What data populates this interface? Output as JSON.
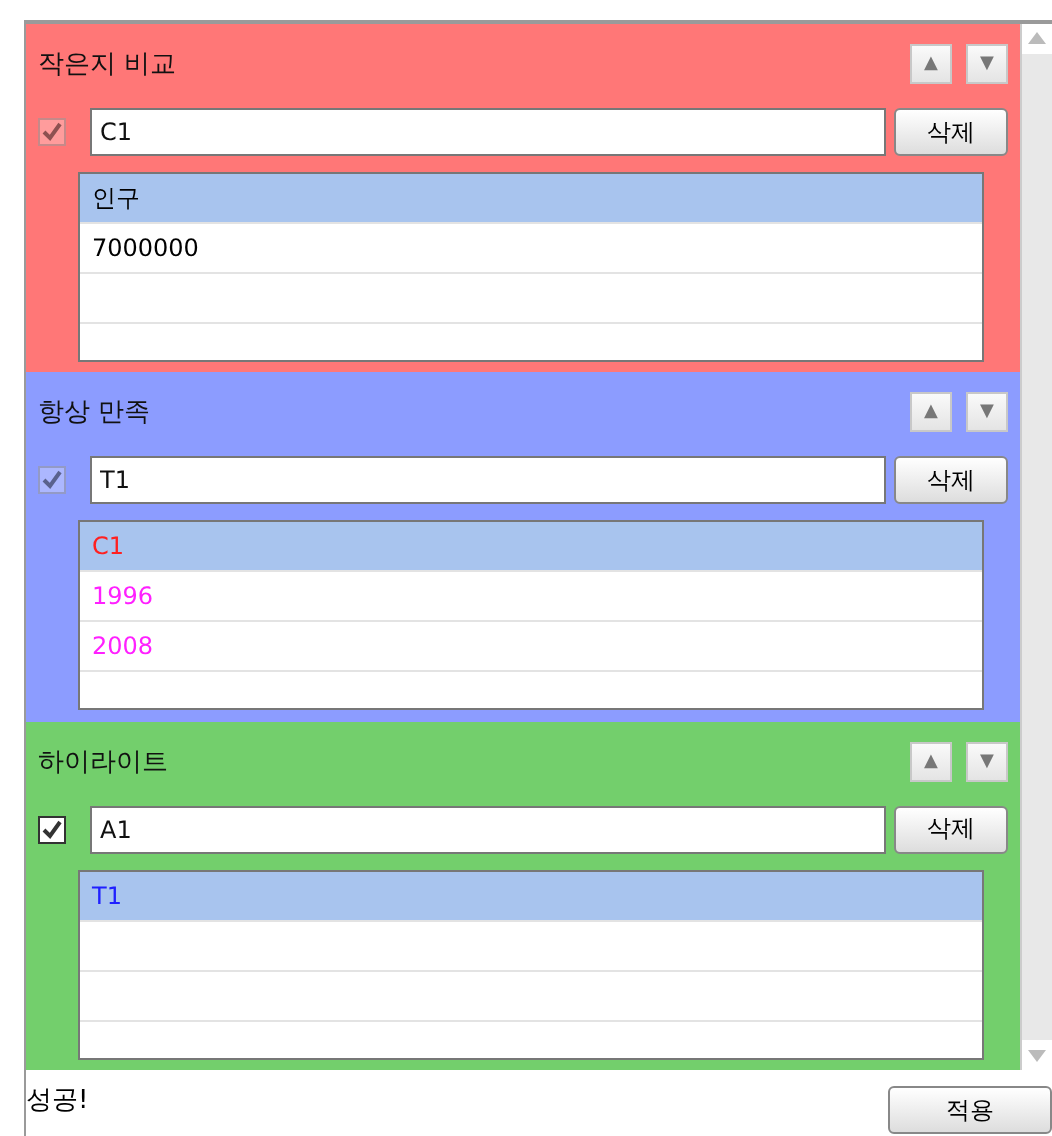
{
  "sections": [
    {
      "title": "작은지 비교",
      "color": "#ff7777",
      "checkbox": {
        "checked": true,
        "disabled": true
      },
      "value": "C1",
      "delete_button": "삭제",
      "move_up": "▲",
      "move_down": "▼",
      "rows": [
        {
          "text": "인구",
          "color": "#000000",
          "selected": true
        },
        {
          "text": "7000000",
          "color": "#000000",
          "selected": false
        }
      ]
    },
    {
      "title": "항상 만족",
      "color": "#8c9cff",
      "checkbox": {
        "checked": true,
        "disabled": true
      },
      "value": "T1",
      "delete_button": "삭제",
      "move_up": "▲",
      "move_down": "▼",
      "rows": [
        {
          "text": "C1",
          "color": "#ff2020",
          "selected": true
        },
        {
          "text": "1996",
          "color": "#ff20ff",
          "selected": false
        },
        {
          "text": "2008",
          "color": "#ff20ff",
          "selected": false
        }
      ]
    },
    {
      "title": "하이라이트",
      "color": "#73cf6c",
      "checkbox": {
        "checked": true,
        "disabled": false
      },
      "value": "A1",
      "delete_button": "삭제",
      "move_up": "▲",
      "move_down": "▼",
      "rows": [
        {
          "text": "T1",
          "color": "#2020ff",
          "selected": true
        }
      ]
    }
  ],
  "status": "성공!",
  "apply_button": "적용"
}
